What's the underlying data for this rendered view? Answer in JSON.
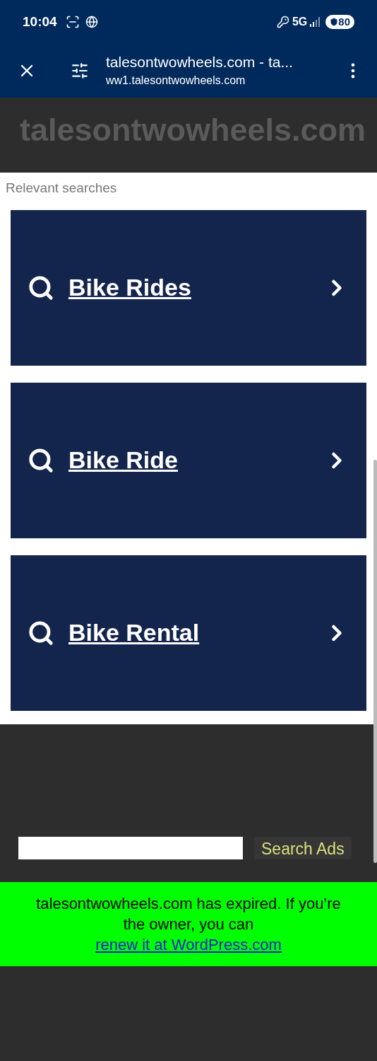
{
  "status_bar": {
    "time": "10:04",
    "network": "5G",
    "battery": "80"
  },
  "toolbar": {
    "title": "talesontwowheels.com - ta...",
    "url": "ww1.talesontwowheels.com"
  },
  "site_header": {
    "title": "talesontwowheels.com"
  },
  "searches": {
    "heading": "Relevant searches",
    "items": [
      {
        "label": "Bike Rides"
      },
      {
        "label": "Bike Ride"
      },
      {
        "label": "Bike Rental"
      }
    ]
  },
  "ad_search": {
    "button": "Search Ads"
  },
  "notice": {
    "text": "talesontwowheels.com has expired. If you’re the owner, you can ",
    "link": "renew it at WordPress.com"
  }
}
